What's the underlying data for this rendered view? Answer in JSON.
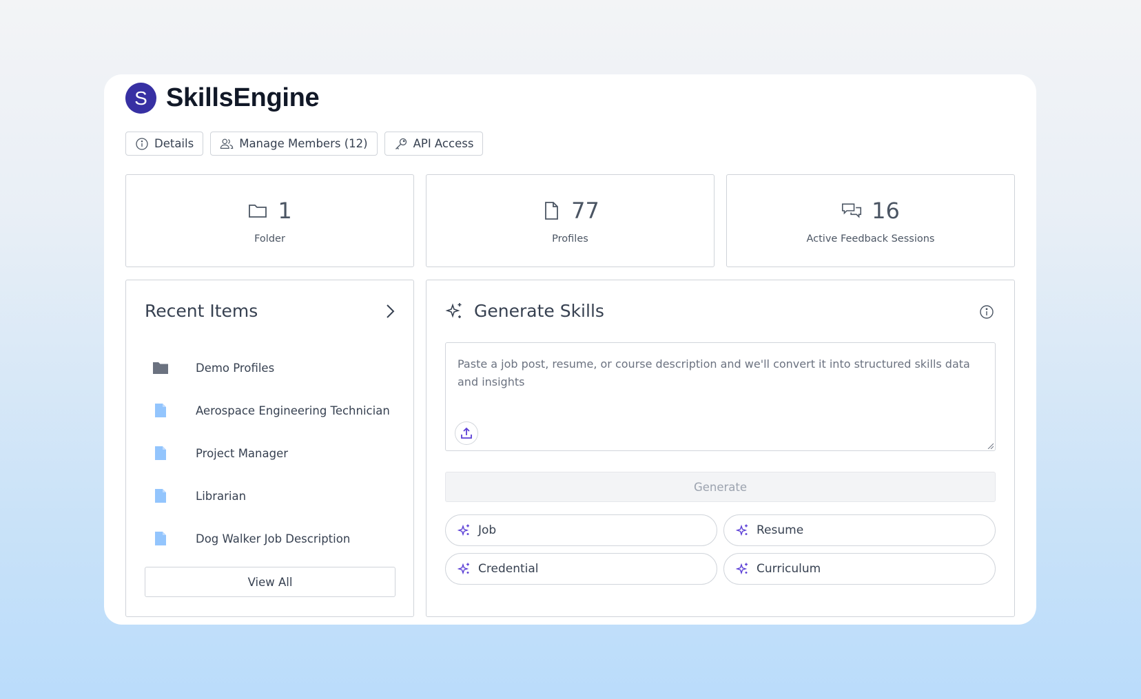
{
  "app": {
    "logo_letter": "S",
    "name": "SkillsEngine",
    "brand_color": "#3730a3"
  },
  "actions": {
    "details_label": "Details",
    "manage_members_label": "Manage Members (12)",
    "api_access_label": "API Access"
  },
  "stats": [
    {
      "icon": "folder-icon",
      "value": "1",
      "label": "Folder"
    },
    {
      "icon": "file-icon",
      "value": "77",
      "label": "Profiles"
    },
    {
      "icon": "chat-bubbles-icon",
      "value": "16",
      "label": "Active Feedback Sessions"
    }
  ],
  "recent": {
    "title": "Recent Items",
    "items": [
      {
        "icon": "folder-icon",
        "label": "Demo Profiles"
      },
      {
        "icon": "file-icon",
        "label": "Aerospace Engineering Technician"
      },
      {
        "icon": "file-icon",
        "label": "Project Manager"
      },
      {
        "icon": "file-icon",
        "label": "Librarian"
      },
      {
        "icon": "file-icon",
        "label": "Dog Walker Job Description"
      }
    ],
    "view_all_label": "View All"
  },
  "generate": {
    "title": "Generate Skills",
    "placeholder": "Paste a job post, resume, or course description and we'll convert it into structured skills data and insights",
    "button_label": "Generate",
    "chips": [
      "Job",
      "Resume",
      "Credential",
      "Curriculum"
    ],
    "accent_color": "#5b3fd6"
  }
}
